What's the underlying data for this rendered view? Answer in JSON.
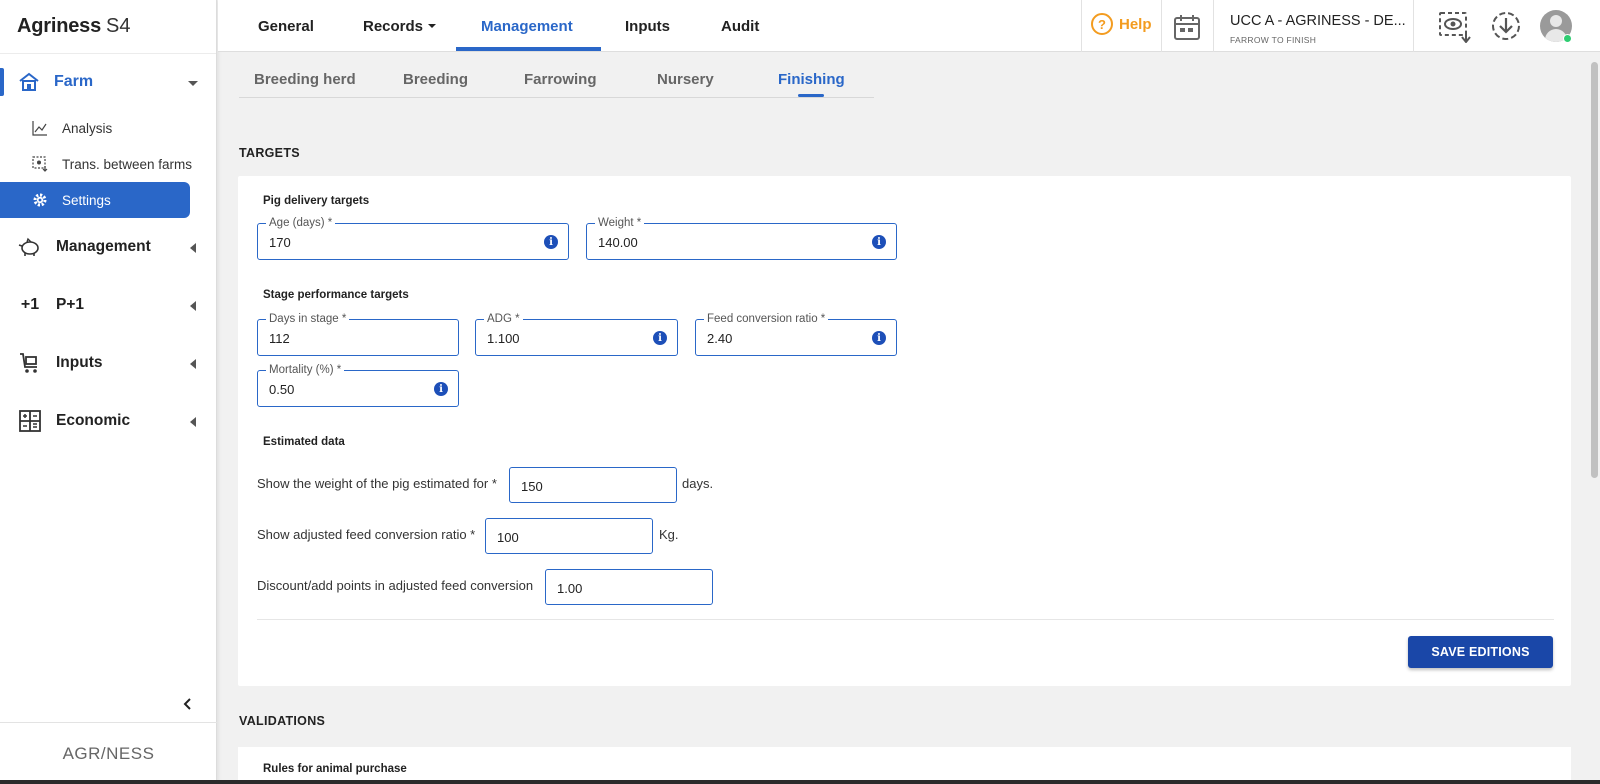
{
  "app": {
    "brand_name": "Agriness",
    "brand_suffix": "S4",
    "footer_logo": "AGR/NESS"
  },
  "sidebar": {
    "farm": {
      "label": "Farm"
    },
    "sub_items": [
      {
        "label": "Analysis",
        "icon": "chart-line-icon"
      },
      {
        "label": "Trans. between farms",
        "icon": "transfer-icon"
      },
      {
        "label": "Settings",
        "icon": "gear-icon"
      }
    ],
    "sections": [
      {
        "label": "Management",
        "icon": "piggy-bank-icon"
      },
      {
        "label": "P+1",
        "icon": "plus-one-icon"
      },
      {
        "label": "Inputs",
        "icon": "cart-icon"
      },
      {
        "label": "Economic",
        "icon": "calculator-icon"
      }
    ]
  },
  "topnav": {
    "items": [
      {
        "label": "General"
      },
      {
        "label": "Records"
      },
      {
        "label": "Management"
      },
      {
        "label": "Inputs"
      },
      {
        "label": "Audit"
      }
    ],
    "active": "Management",
    "help_label": "Help",
    "farm_name": "UCC A - AGRINESS - DE...",
    "farm_type": "FARROW TO FINISH"
  },
  "subtabs": {
    "items": [
      {
        "label": "Breeding herd"
      },
      {
        "label": "Breeding"
      },
      {
        "label": "Farrowing"
      },
      {
        "label": "Nursery"
      },
      {
        "label": "Finishing"
      }
    ],
    "active": "Finishing"
  },
  "targets": {
    "heading": "TARGETS",
    "delivery": {
      "heading": "Pig delivery targets",
      "age": {
        "label": "Age (days) *",
        "value": "170"
      },
      "weight": {
        "label": "Weight *",
        "value": "140.00"
      }
    },
    "performance": {
      "heading": "Stage performance targets",
      "days": {
        "label": "Days in stage *",
        "value": "112"
      },
      "adg": {
        "label": "ADG *",
        "value": "1.100"
      },
      "fcr": {
        "label": "Feed conversion ratio *",
        "value": "2.40"
      },
      "mortality": {
        "label": "Mortality (%) *",
        "value": "0.50"
      }
    },
    "estimated": {
      "heading": "Estimated data",
      "weight_row": {
        "label": "Show the weight of the pig estimated for *",
        "value": "150",
        "unit": "days."
      },
      "fcr_row": {
        "label": "Show adjusted feed conversion ratio *",
        "value": "100",
        "unit": "Kg."
      },
      "discount_row": {
        "label": "Discount/add points in adjusted feed conversion",
        "value": "1.00"
      }
    },
    "save_label": "SAVE EDITIONS"
  },
  "validations": {
    "heading": "VALIDATIONS",
    "rules_heading": "Rules for animal purchase"
  },
  "colors": {
    "accent": "#2a67c8",
    "button": "#1a47a8",
    "help": "#f39c20"
  }
}
